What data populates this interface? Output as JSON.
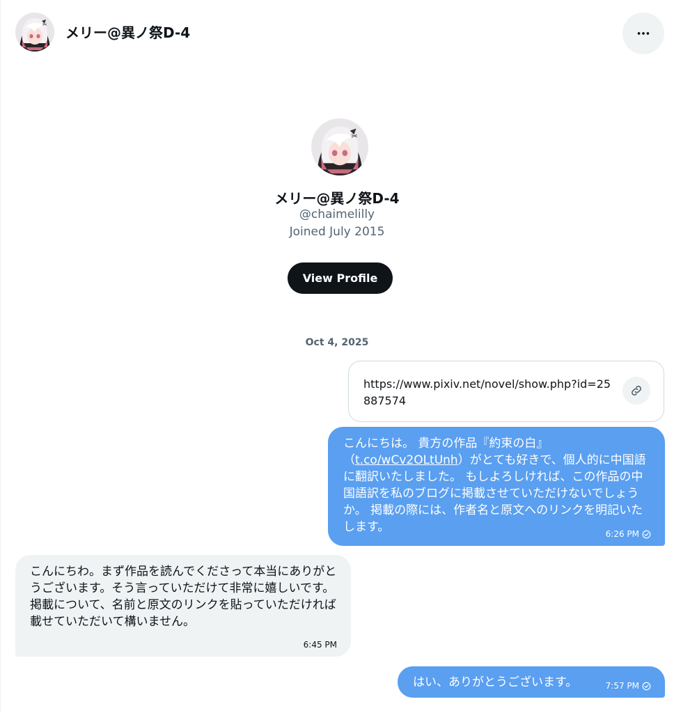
{
  "header": {
    "name": "メリー@異ノ祭D-4",
    "more_icon": "more-horizontal-icon"
  },
  "profile": {
    "name": "メリー@異ノ祭D-4",
    "handle": "@chaimelilly",
    "joined": "Joined July 2015",
    "view_button": "View Profile"
  },
  "conversation": {
    "date": "Oct 4, 2025",
    "link_card": {
      "url": "https://www.pixiv.net/novel/show.php?id=25887574",
      "icon": "link-icon"
    },
    "messages": [
      {
        "direction": "outgoing",
        "text_before": "こんにちは。 貴方の作品『約束の白』（",
        "link": "t.co/wCv2OLtUnh",
        "text_after": "）がとても好きで、個人的に中国語に翻訳いたしました。 もしよろしければ、この作品の中国語訳を私のブログに掲載させていただけないでしょうか。 掲載の際には、作者名と原文へのリンクを明記いたします。",
        "time": "6:26 PM",
        "status_icon": "read-check-icon"
      },
      {
        "direction": "incoming",
        "text": "こんにちわ。まず作品を読んでくださって本当にありがとうございます。そう言っていただけて非常に嬉しいです。\n掲載について、名前と原文のリンクを貼っていただければ載せていただいて構いません。",
        "time": "6:45 PM"
      },
      {
        "direction": "outgoing",
        "text": "はい、ありがとうございます。",
        "time": "7:57 PM",
        "status_icon": "read-check-icon"
      }
    ]
  },
  "colors": {
    "outgoing_bubble": "#5a9ff0",
    "incoming_bubble": "#eff3f4",
    "primary_button": "#0f1419"
  }
}
